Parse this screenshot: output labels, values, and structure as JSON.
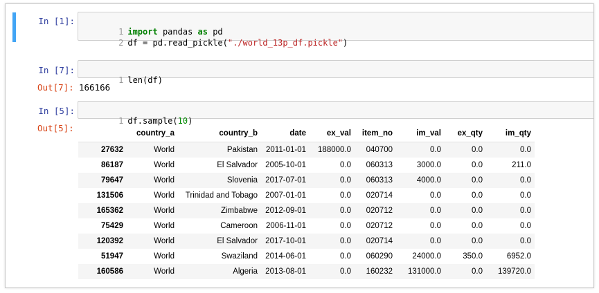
{
  "cells": [
    {
      "prompt": "In [1]:",
      "lines": [
        {
          "num": "1",
          "parts": [
            {
              "t": "kw",
              "v": "import"
            },
            {
              "t": "plain",
              "v": " pandas "
            },
            {
              "t": "kw",
              "v": "as"
            },
            {
              "t": "plain",
              "v": " pd"
            }
          ]
        },
        {
          "num": "2",
          "parts": [
            {
              "t": "plain",
              "v": "df = pd.read_pickle("
            },
            {
              "t": "str",
              "v": "\"./world_13p_df.pickle\""
            },
            {
              "t": "plain",
              "v": ")"
            }
          ]
        }
      ]
    },
    {
      "prompt": "In [7]:",
      "lines": [
        {
          "num": "1",
          "parts": [
            {
              "t": "plain",
              "v": "len(df)"
            }
          ]
        }
      ],
      "out_prompt": "Out[7]:",
      "output": "166166"
    },
    {
      "prompt": "In [5]:",
      "lines": [
        {
          "num": "1",
          "parts": [
            {
              "t": "plain",
              "v": "df.sample("
            },
            {
              "t": "num",
              "v": "10"
            },
            {
              "t": "plain",
              "v": ")"
            }
          ]
        }
      ],
      "out_prompt": "Out[5]:"
    }
  ],
  "dataframe": {
    "columns": [
      "",
      "country_a",
      "country_b",
      "date",
      "ex_val",
      "item_no",
      "im_val",
      "ex_qty",
      "im_qty"
    ],
    "rows": [
      [
        "27632",
        "World",
        "Pakistan",
        "2011-01-01",
        "188000.0",
        "040700",
        "0.0",
        "0.0",
        "0.0"
      ],
      [
        "86187",
        "World",
        "El Salvador",
        "2005-10-01",
        "0.0",
        "060313",
        "3000.0",
        "0.0",
        "211.0"
      ],
      [
        "79647",
        "World",
        "Slovenia",
        "2017-07-01",
        "0.0",
        "060313",
        "4000.0",
        "0.0",
        "0.0"
      ],
      [
        "131506",
        "World",
        "Trinidad and Tobago",
        "2007-01-01",
        "0.0",
        "020714",
        "0.0",
        "0.0",
        "0.0"
      ],
      [
        "165362",
        "World",
        "Zimbabwe",
        "2012-09-01",
        "0.0",
        "020712",
        "0.0",
        "0.0",
        "0.0"
      ],
      [
        "75429",
        "World",
        "Cameroon",
        "2006-11-01",
        "0.0",
        "020712",
        "0.0",
        "0.0",
        "0.0"
      ],
      [
        "120392",
        "World",
        "El Salvador",
        "2017-10-01",
        "0.0",
        "020714",
        "0.0",
        "0.0",
        "0.0"
      ],
      [
        "51947",
        "World",
        "Swaziland",
        "2014-06-01",
        "0.0",
        "060290",
        "24000.0",
        "350.0",
        "6952.0"
      ],
      [
        "160586",
        "World",
        "Algeria",
        "2013-08-01",
        "0.0",
        "160232",
        "131000.0",
        "0.0",
        "139720.0"
      ]
    ]
  }
}
